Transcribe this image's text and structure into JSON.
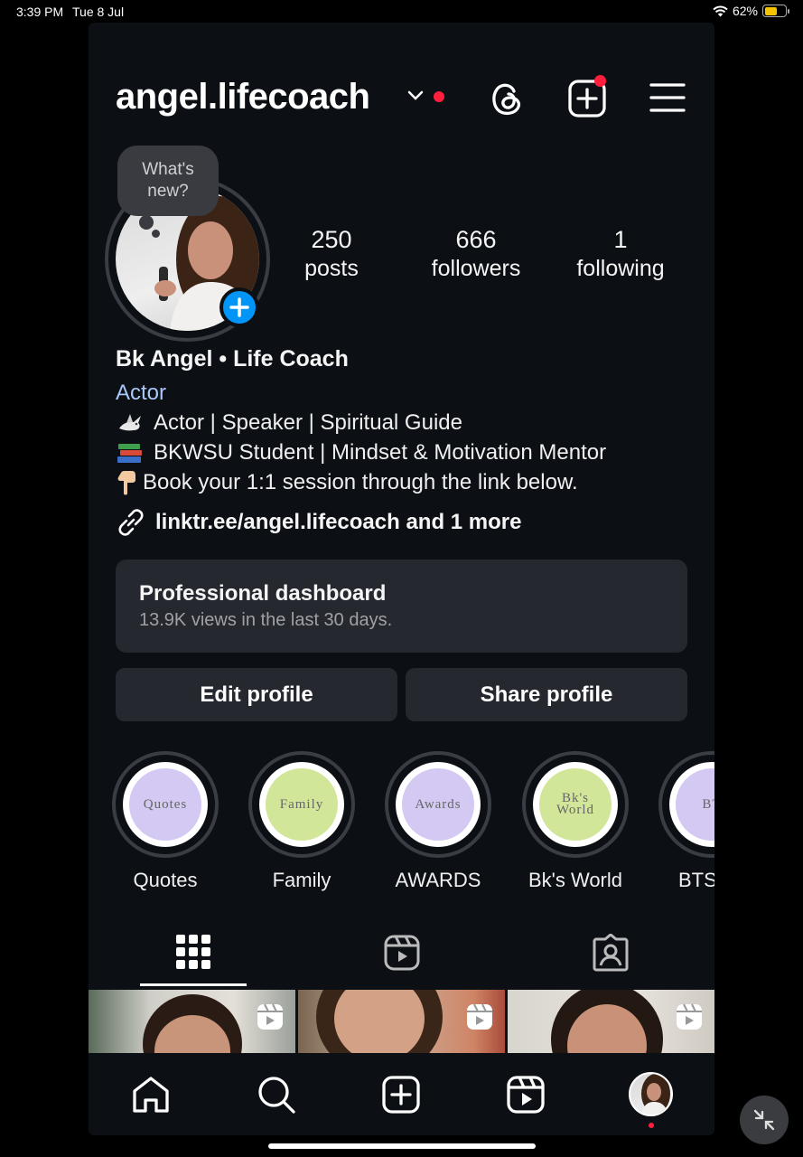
{
  "status_bar": {
    "time": "3:39 PM",
    "date": "Tue 8 Jul",
    "battery": "62%",
    "battery_level": 0.62
  },
  "header": {
    "username": "angel.lifecoach",
    "icons": [
      "chevron-down-icon",
      "threads-icon",
      "new-post-icon",
      "menu-icon"
    ]
  },
  "profile": {
    "note_bubble": {
      "line1": "What's",
      "line2": "new?"
    },
    "stats": {
      "posts": {
        "value": "250",
        "label": "posts"
      },
      "followers": {
        "value": "666",
        "label": "followers"
      },
      "following": {
        "value": "1",
        "label": "following"
      }
    },
    "full_name": "Bk Angel • Life Coach",
    "category": "Actor",
    "bio": [
      {
        "icon": "dove-emoji",
        "text": "Actor | Speaker | Spiritual Guide"
      },
      {
        "icon": "books-emoji",
        "text": "BKWSU Student | Mindset & Motivation Mentor"
      },
      {
        "icon": "pointing-down-emoji",
        "text": "Book your 1:1 session through the link below."
      }
    ],
    "link": "linktr.ee/angel.lifecoach and 1 more"
  },
  "dashboard": {
    "title": "Professional dashboard",
    "subtitle": "13.9K views in the last 30 days."
  },
  "buttons": {
    "edit": "Edit profile",
    "share": "Share profile"
  },
  "highlights": [
    {
      "cover_text": "Quotes",
      "label": "Quotes",
      "color": "#d3c9f2"
    },
    {
      "cover_text": "Family",
      "label": "Family",
      "color": "#d2e69a"
    },
    {
      "cover_text": "Awards",
      "label": "AWARDS",
      "color": "#d3c9f2"
    },
    {
      "cover_text": "Bk's World",
      "label": "Bk's World",
      "color": "#d2e69a"
    },
    {
      "cover_text": "BT",
      "label": "BTS",
      "color": "#d3c9f2"
    }
  ],
  "tabs": [
    "grid-icon",
    "reels-icon",
    "tagged-icon"
  ],
  "bottom_nav": [
    "home-icon",
    "search-icon",
    "create-icon",
    "reels-icon",
    "profile-avatar"
  ],
  "colors": {
    "accent": "#0095f6",
    "notification": "#ff1f3d",
    "link": "#a8c7fa",
    "background": "#0c0f14"
  }
}
